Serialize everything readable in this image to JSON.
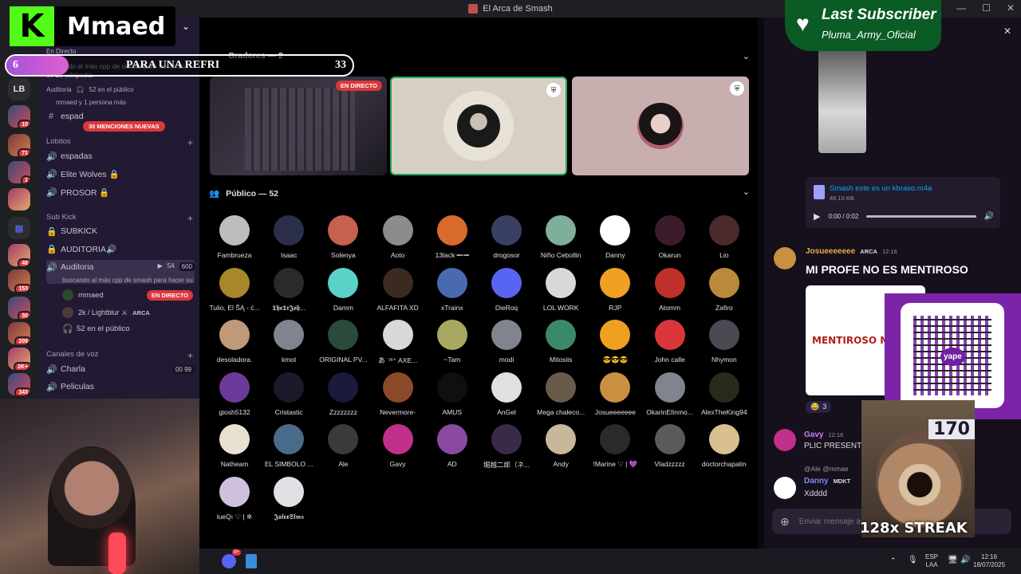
{
  "window": {
    "title": "El Arca de Smash",
    "controls": [
      "?",
      "—",
      "☐",
      "✕"
    ]
  },
  "rail": {
    "home_label": "LB",
    "servers": [
      {
        "badge": "10"
      },
      {
        "badge": "71"
      },
      {
        "badge": "1"
      },
      {
        "badge": ""
      },
      {
        "badge": ""
      },
      {
        "badge": "48"
      },
      {
        "badge": "153"
      },
      {
        "badge": "30"
      },
      {
        "badge": "209"
      },
      {
        "badge": "2K+"
      },
      {
        "badge": "343"
      }
    ]
  },
  "sidebar": {
    "top_status": "En Directo",
    "top_desc": "buscando al más cpp de smash para hacer su ev de wikipedia",
    "top_auditoria": "Auditoria",
    "top_public": "52 en el público",
    "top_members": "mmaed y 1 persona más",
    "espada_label": "espad",
    "mentions": "30 MENCIONES NUEVAS",
    "categories": [
      {
        "name": "Lobitos",
        "channels": [
          "espadas",
          "Elite Wolves 🔒",
          "PROSOR 🔒"
        ]
      },
      {
        "name": "Sub Kick",
        "channels": [
          "SUBKICK",
          "AUDITORIA🔊",
          "Auditoria"
        ]
      }
    ],
    "auditoria_counts": {
      "video": "54",
      "listeners": "600"
    },
    "auditoria_desc": "buscando al más cpp de smash para hacer su...",
    "auditoria_users": [
      {
        "name": "mmaed",
        "tag": "EN DIRECTO"
      },
      {
        "name": "2k / Lightblur ⚔",
        "tag": "ARCA"
      },
      {
        "name": "52 en el público",
        "tag": ""
      }
    ],
    "voice_category": "Canales de voz",
    "voice_channels": [
      {
        "name": "Charla",
        "counts": "00 99"
      },
      {
        "name": "Peliculas",
        "counts": ""
      }
    ]
  },
  "stage": {
    "speakers_title": "Oradores — 2",
    "live_tag": "EN DIRECTO",
    "public_title": "Público — 52",
    "members": [
      {
        "name": "Fambrueza",
        "color": "#bdbdbd"
      },
      {
        "name": "Isaac",
        "color": "#2b2f4a"
      },
      {
        "name": "Solenya",
        "color": "#c8604f"
      },
      {
        "name": "Aoto",
        "color": "#8c8c8c"
      },
      {
        "name": "13lack ━┉━",
        "color": "#d86a2c"
      },
      {
        "name": "drogosor",
        "color": "#3a3f66"
      },
      {
        "name": "Niño Cebollin",
        "color": "#7fae9a"
      },
      {
        "name": "Danny",
        "color": "#ffffff"
      },
      {
        "name": "Okarun",
        "color": "#3b1c2c"
      },
      {
        "name": "Lio",
        "color": "#4a2a2a"
      },
      {
        "name": "Tulio, El ŠĄ - ċ...",
        "color": "#a8862a"
      },
      {
        "name": "𝕿𝖍𝖊𝕿𝖗𝕵𝖔𝖍...",
        "color": "#2a2a2a"
      },
      {
        "name": "Damm",
        "color": "#5ad2c8"
      },
      {
        "name": "ALFAFITA XD",
        "color": "#3a2a20"
      },
      {
        "name": "xTrainx",
        "color": "#4a6ab0"
      },
      {
        "name": "DieRoq",
        "color": "#5865f2"
      },
      {
        "name": "LOL WORK",
        "color": "#d8d8d8"
      },
      {
        "name": "RJP",
        "color": "#f0a020"
      },
      {
        "name": "Atomm",
        "color": "#c0302a"
      },
      {
        "name": "Zafiro",
        "color": "#b88a3a"
      },
      {
        "name": "desoladora.",
        "color": "#c09a78"
      },
      {
        "name": "kmot",
        "color": "#80848e"
      },
      {
        "name": "ORIGINAL PV...",
        "color": "#2a4a3a"
      },
      {
        "name": "あ ˙ᵐ⁺ AXE...",
        "color": "#d8d8d8"
      },
      {
        "name": "~Tam",
        "color": "#a8a860"
      },
      {
        "name": "modi",
        "color": "#80848e"
      },
      {
        "name": "Mitosiis",
        "color": "#3a8a6a"
      },
      {
        "name": "😎😎😎",
        "color": "#f0a020"
      },
      {
        "name": "John calle",
        "color": "#da373c"
      },
      {
        "name": "Nhymon",
        "color": "#4a4a52"
      },
      {
        "name": "giosh5132",
        "color": "#6a3a9a"
      },
      {
        "name": "Cristastic",
        "color": "#1a1a2a"
      },
      {
        "name": "Zzzzzzzz",
        "color": "#1a1a3a"
      },
      {
        "name": "Nevermore-",
        "color": "#8a4a2a"
      },
      {
        "name": "AMUS",
        "color": "#0f0f0f"
      },
      {
        "name": "AnGel",
        "color": "#e0e0e0"
      },
      {
        "name": "Mega chaleco...",
        "color": "#6a5a4a"
      },
      {
        "name": "Josueeeeeee",
        "color": "#c89040"
      },
      {
        "name": "OkarinElInmo...",
        "color": "#80848e"
      },
      {
        "name": "AlexTheKing94",
        "color": "#2a2a1a"
      },
      {
        "name": "Natheam",
        "color": "#e8e0d0"
      },
      {
        "name": "EL SIMBOLO ...",
        "color": "#4a6a8a"
      },
      {
        "name": "Ale",
        "color": "#3a3a3a"
      },
      {
        "name": "Gavy",
        "color": "#c0308a"
      },
      {
        "name": "AD",
        "color": "#8a4aa0"
      },
      {
        "name": "堀越二郎（ネ...",
        "color": "#3a2a4a"
      },
      {
        "name": "Andy",
        "color": "#c8b89a"
      },
      {
        "name": "!Marine ♡ | 💜",
        "color": "#2a2a2a"
      },
      {
        "name": "Vladzzzzz",
        "color": "#5a5a5a"
      },
      {
        "name": "doctorchapatin",
        "color": "#d8c090"
      },
      {
        "name": "lueQı ♡ | ✲",
        "color": "#d0c0e0"
      },
      {
        "name": "𝕵𝖚𝖑𝖊𝖝𝕾𝖑𝖒𝖘",
        "color": "#dfe0e3"
      }
    ]
  },
  "chat": {
    "file_name": "Smash este es un kbraso.m4a",
    "file_size": "49.10 KB",
    "audio_time": "0:00 / 0:02",
    "msg1_author": "Josueeeeeee",
    "msg1_tag": "ARCA",
    "msg1_time": "12:16",
    "msg1_text": "MI PROFE NO ES MENTIROSO",
    "image_text": "MENTIROSO ME",
    "reaction_count": "3",
    "msg2_author": "Gavy",
    "msg2_time": "12:16",
    "msg2_text": "PLIC PRESENTE",
    "reply_preview": "@Ale @mmae",
    "msg3_author": "Danny",
    "msg3_tag": "MDKT",
    "msg3_text": "Xdddd",
    "input_placeholder": "Enviar mensaje a #auditoria"
  },
  "overlay": {
    "brand_letter": "K",
    "brand_name": "Mmaed",
    "goal_current": "6",
    "goal_text": "PARA UNA REFRI",
    "goal_target": "33",
    "goal_fraction": 0.18,
    "last_sub_title": "Last Subscriber",
    "last_sub_name": "Pluma_Army_Oficial",
    "qr_brand": "yape",
    "streak_count": "170",
    "streak_text": "128x STREAK"
  },
  "taskbar": {
    "lang": "ESP",
    "lang2": "LAA",
    "time": "12:16",
    "date": "18/07/2025",
    "discord_badge": "9+"
  },
  "colors": {
    "live": "#da373c",
    "online": "#23a55a",
    "kick_green": "#53fc18",
    "sidebar": "#221a33"
  }
}
